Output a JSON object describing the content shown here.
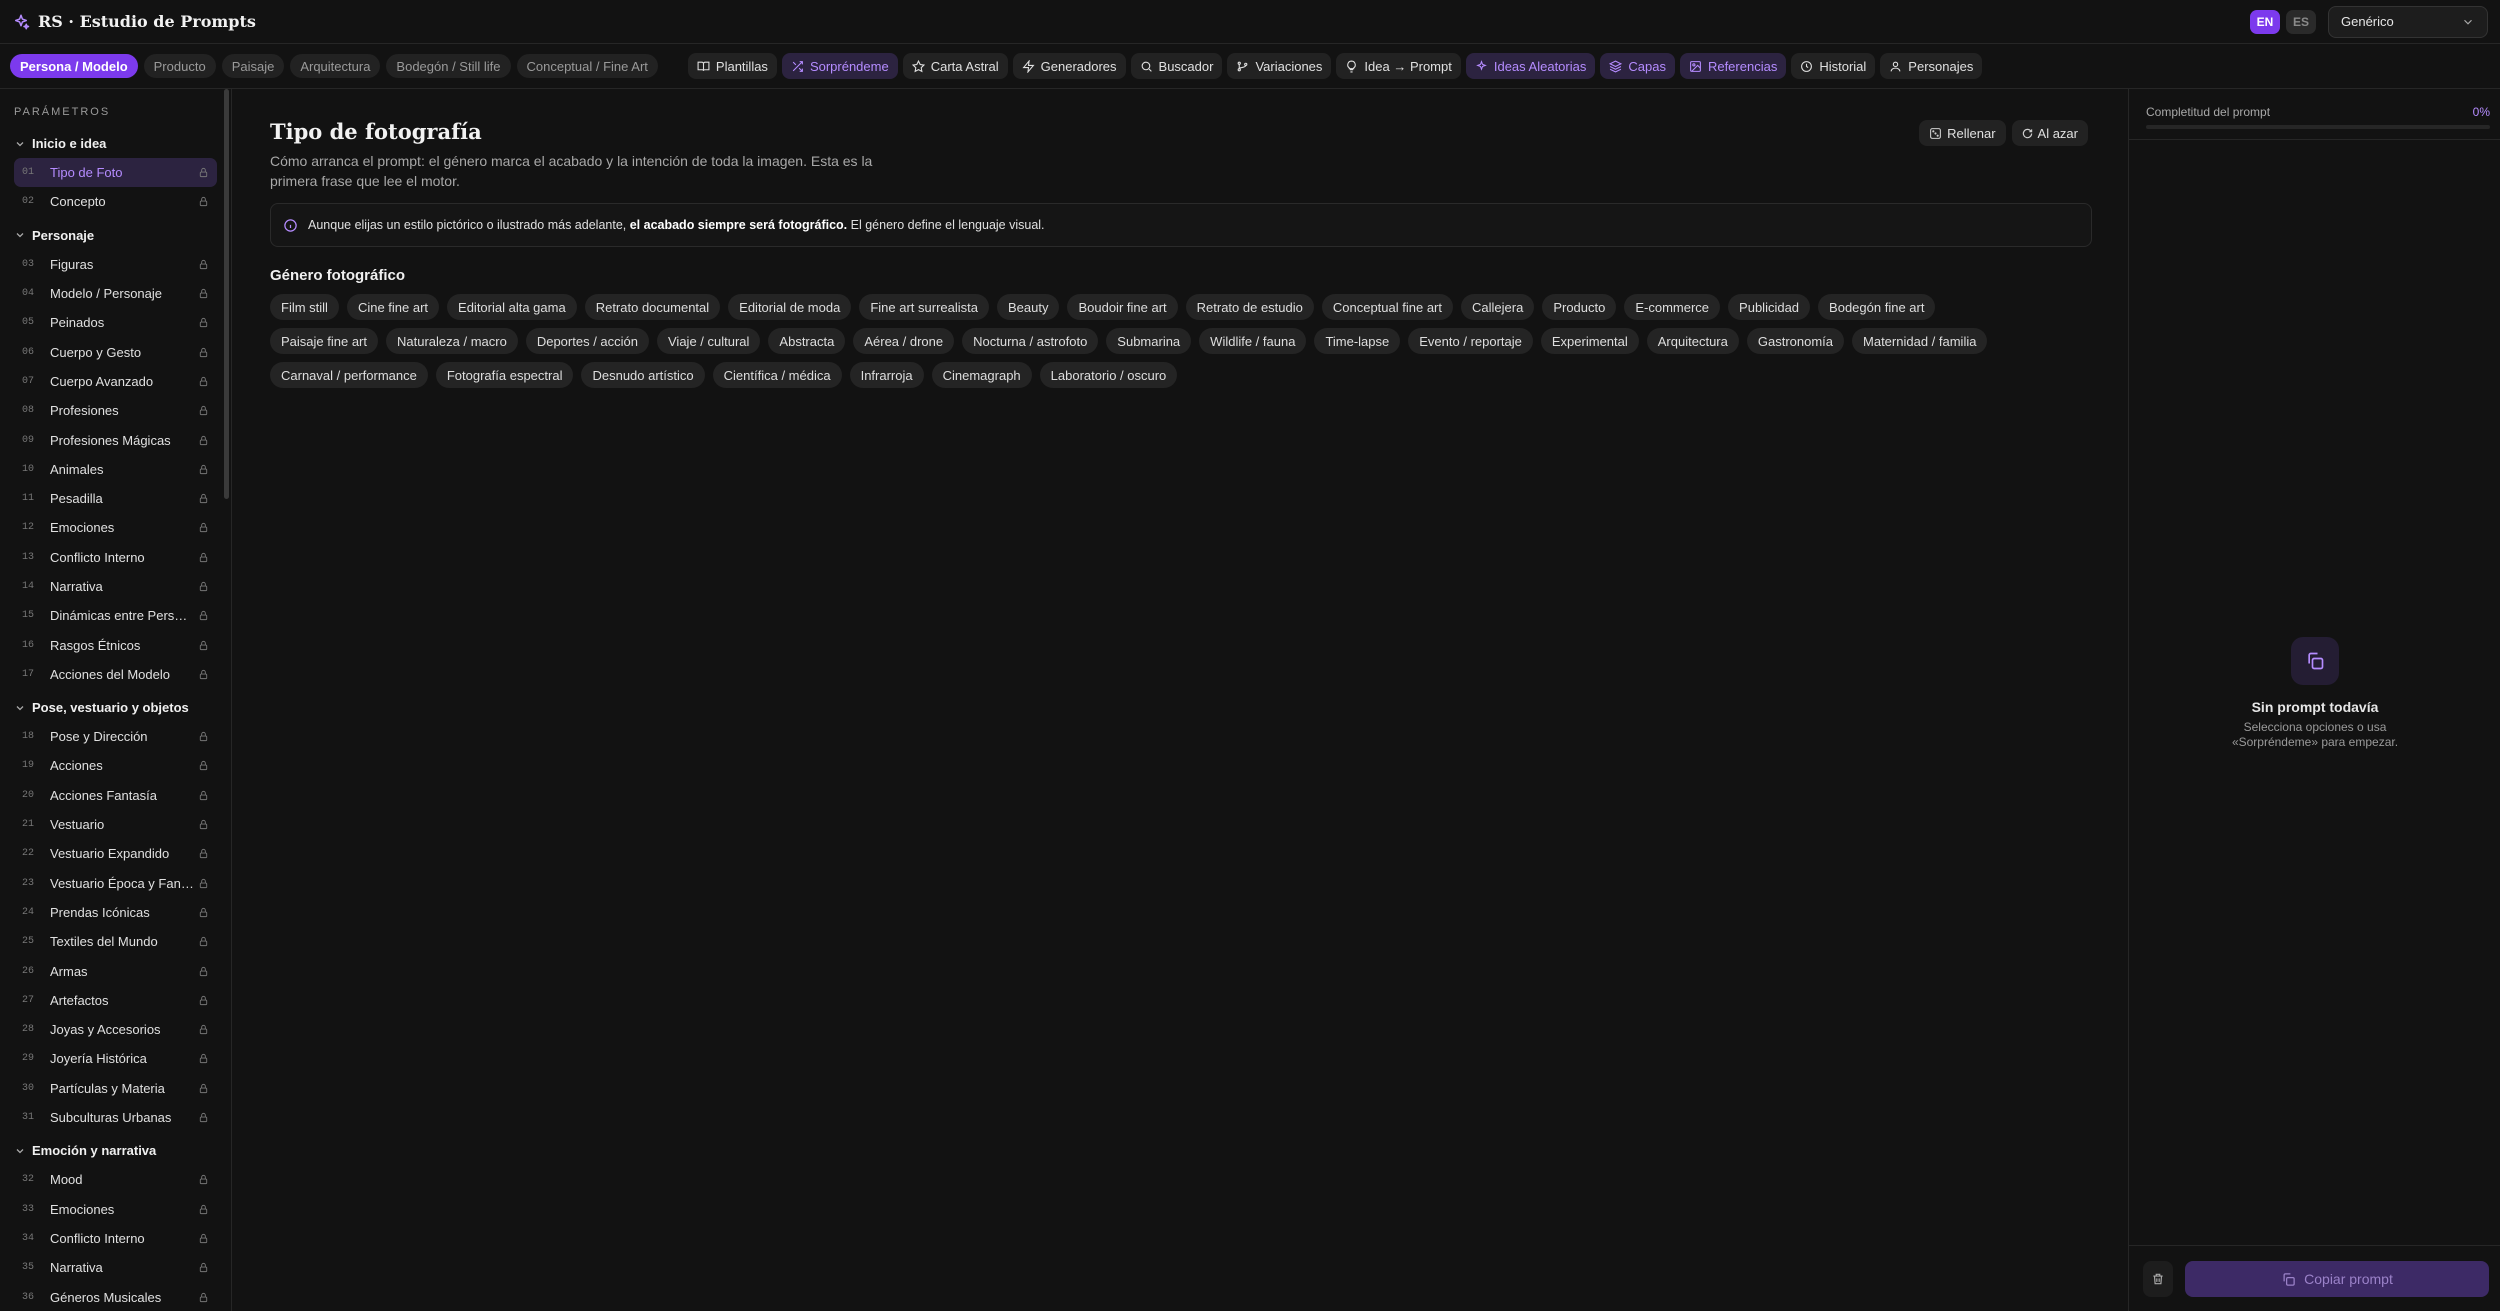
{
  "app": {
    "title": "RS · Estudio de Prompts"
  },
  "languages": [
    {
      "label": "EN",
      "active": true
    },
    {
      "label": "ES",
      "active": false
    }
  ],
  "model_select": {
    "value": "Genérico"
  },
  "categories": [
    "Persona / Modelo",
    "Producto",
    "Paisaje",
    "Arquitectura",
    "Bodegón / Still life",
    "Conceptual / Fine Art"
  ],
  "tools": [
    {
      "label": "Plantillas",
      "icon": "book-icon"
    },
    {
      "label": "Sorpréndeme",
      "icon": "shuffle-icon"
    },
    {
      "label": "Carta Astral",
      "icon": "star-icon"
    },
    {
      "label": "Generadores",
      "icon": "zap-icon"
    },
    {
      "label": "Buscador",
      "icon": "search-icon"
    },
    {
      "label": "Variaciones",
      "icon": "git-branch-icon"
    },
    {
      "label": "Idea → Prompt",
      "icon": "lightbulb-icon"
    },
    {
      "label": "Ideas Aleatorias",
      "icon": "sparkles-icon"
    },
    {
      "label": "Capas",
      "icon": "layers-icon"
    },
    {
      "label": "Referencias",
      "icon": "image-icon"
    },
    {
      "label": "Historial",
      "icon": "clock-icon"
    },
    {
      "label": "Personajes",
      "icon": "user-icon"
    }
  ],
  "sidebar": {
    "title": "PARÁMETROS",
    "groups": [
      {
        "title": "Inicio e idea",
        "items": [
          [
            "01",
            "Tipo de Foto"
          ],
          [
            "02",
            "Concepto"
          ]
        ]
      },
      {
        "title": "Personaje",
        "items": [
          [
            "03",
            "Figuras"
          ],
          [
            "04",
            "Modelo / Personaje"
          ],
          [
            "05",
            "Peinados"
          ],
          [
            "06",
            "Cuerpo y Gesto"
          ],
          [
            "07",
            "Cuerpo Avanzado"
          ],
          [
            "08",
            "Profesiones"
          ],
          [
            "09",
            "Profesiones Mágicas"
          ],
          [
            "10",
            "Animales"
          ],
          [
            "11",
            "Pesadilla"
          ],
          [
            "12",
            "Emociones"
          ],
          [
            "13",
            "Conflicto Interno"
          ],
          [
            "14",
            "Narrativa"
          ],
          [
            "15",
            "Dinámicas entre Personajes"
          ],
          [
            "16",
            "Rasgos Étnicos"
          ],
          [
            "17",
            "Acciones del Modelo"
          ]
        ]
      },
      {
        "title": "Pose, vestuario y objetos",
        "items": [
          [
            "18",
            "Pose y Dirección"
          ],
          [
            "19",
            "Acciones"
          ],
          [
            "20",
            "Acciones Fantasía"
          ],
          [
            "21",
            "Vestuario"
          ],
          [
            "22",
            "Vestuario Expandido"
          ],
          [
            "23",
            "Vestuario Época y Fantasía"
          ],
          [
            "24",
            "Prendas Icónicas"
          ],
          [
            "25",
            "Textiles del Mundo"
          ],
          [
            "26",
            "Armas"
          ],
          [
            "27",
            "Artefactos"
          ],
          [
            "28",
            "Joyas y Accesorios"
          ],
          [
            "29",
            "Joyería Histórica"
          ],
          [
            "30",
            "Partículas y Materia"
          ],
          [
            "31",
            "Subculturas Urbanas"
          ]
        ]
      },
      {
        "title": "Emoción y narrativa",
        "items": [
          [
            "32",
            "Mood"
          ],
          [
            "33",
            "Emociones"
          ],
          [
            "34",
            "Conflicto Interno"
          ],
          [
            "35",
            "Narrativa"
          ],
          [
            "36",
            "Géneros Musicales"
          ]
        ]
      }
    ]
  },
  "main": {
    "title": "Tipo de fotografía",
    "description": "Cómo arranca el prompt: el género marca el acabado y la intención de toda la imagen. Esta es la primera frase que lee el motor.",
    "actions": {
      "fill": "Rellenar",
      "random": "Al azar"
    },
    "notice": {
      "before": "Aunque elijas un estilo pictórico o ilustrado más adelante, ",
      "bold": "el acabado siempre será fotográfico.",
      "after": " El género define el lenguaje visual."
    },
    "section_title": "Género fotográfico",
    "genres": [
      "Film still",
      "Cine fine art",
      "Editorial alta gama",
      "Retrato documental",
      "Editorial de moda",
      "Fine art surrealista",
      "Beauty",
      "Boudoir fine art",
      "Retrato de estudio",
      "Conceptual fine art",
      "Callejera",
      "Producto",
      "E-commerce",
      "Publicidad",
      "Bodegón fine art",
      "Paisaje fine art",
      "Naturaleza / macro",
      "Deportes / acción",
      "Viaje / cultural",
      "Abstracta",
      "Aérea / drone",
      "Nocturna / astrofoto",
      "Submarina",
      "Wildlife / fauna",
      "Time-lapse",
      "Evento / reportaje",
      "Experimental",
      "Arquitectura",
      "Gastronomía",
      "Maternidad / familia",
      "Carnaval / performance",
      "Fotografía espectral",
      "Desnudo artístico",
      "Científica / médica",
      "Infrarroja",
      "Cinemagraph",
      "Laboratorio / oscuro"
    ]
  },
  "right_panel": {
    "completeness_label": "Completitud del prompt",
    "completeness_value": "0%",
    "completeness_fraction": 0,
    "empty_title": "Sin prompt todavía",
    "empty_subtitle": "Selecciona opciones o usa «Sorpréndeme» para empezar.",
    "copy_label": "Copiar prompt"
  },
  "colors": {
    "accent": "#7c3aed",
    "accent_text": "#b58cff",
    "background": "#121212"
  }
}
